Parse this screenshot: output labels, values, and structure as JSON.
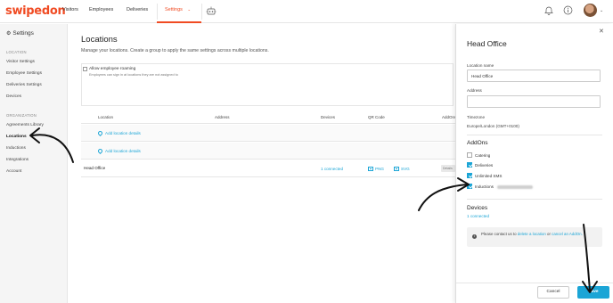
{
  "brand": {
    "logo": "swipedon",
    "accent": "#f04b23",
    "link_color": "#1ba5d6"
  },
  "topnav": {
    "items": [
      {
        "label": "Visitors"
      },
      {
        "label": "Employees"
      },
      {
        "label": "Deliveries"
      },
      {
        "label": "Settings"
      }
    ],
    "icons": [
      "robot-icon",
      "bell-icon",
      "info-icon",
      "avatar"
    ]
  },
  "sidebar": {
    "title": "Settings",
    "location_section": "LOCATION",
    "location_items": [
      "Visitor Settings",
      "Employee Settings",
      "Deliveries Settings",
      "Devices"
    ],
    "org_section": "ORGANIZATION",
    "org_items": [
      "Agreements Library",
      "Locations",
      "Inductions",
      "Integrations",
      "Account"
    ]
  },
  "main": {
    "title": "Locations",
    "subtitle": "Manage your locations. Create a group to apply the same settings across multiple locations.",
    "roaming": {
      "label": "Allow employee roaming",
      "description": "Employees can sign in at locations they are not assigned to"
    },
    "table": {
      "headers": [
        "Location",
        "Address",
        "Devices",
        "QR Code",
        "AddOns"
      ],
      "group_rows": [
        {
          "link": "Add location details"
        },
        {
          "link": "Add location details"
        }
      ],
      "rows": [
        {
          "location": "Head Office",
          "devices": "1 connected",
          "qr_png": "PNG",
          "qr_svg": "SVG",
          "action": "Details"
        }
      ]
    }
  },
  "drawer": {
    "title": "Head Office",
    "location_name_label": "Location name",
    "location_name_value": "Head Office",
    "address_label": "Address",
    "address_value": "",
    "timezone_label": "Timezone",
    "timezone_value": "Europe/London (GMT+0100)",
    "addons_title": "AddOns",
    "addons": [
      {
        "label": "Catering",
        "checked": false
      },
      {
        "label": "Deliveries",
        "checked": true
      },
      {
        "label": "Unlimited SMS",
        "checked": true
      },
      {
        "label": "Inductions",
        "checked": true
      }
    ],
    "devices_title": "Devices",
    "devices_link": "1 connected",
    "info": {
      "prefix": "Please contact us to",
      "link1": "delete a location",
      "middle": "or",
      "link2": "cancel an AddOn."
    },
    "cancel_label": "Cancel",
    "save_label": "Save"
  }
}
